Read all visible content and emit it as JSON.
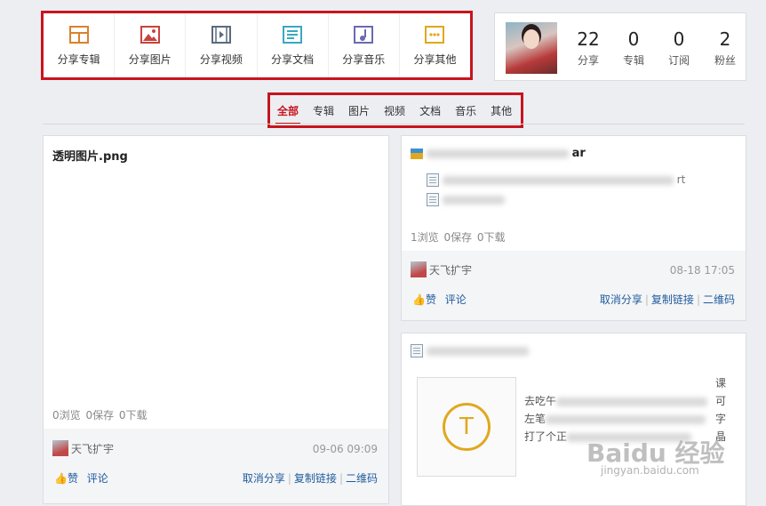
{
  "share_toolbar": {
    "buttons": [
      {
        "label": "分享专辑",
        "icon": "album-icon",
        "color": "#d9822b"
      },
      {
        "label": "分享图片",
        "icon": "image-icon",
        "color": "#c8443c"
      },
      {
        "label": "分享视频",
        "icon": "video-icon",
        "color": "#5a6b7d"
      },
      {
        "label": "分享文档",
        "icon": "document-icon",
        "color": "#3aa7c4"
      },
      {
        "label": "分享音乐",
        "icon": "music-icon",
        "color": "#6a6ab0"
      },
      {
        "label": "分享其他",
        "icon": "more-icon",
        "color": "#e0a81e"
      }
    ]
  },
  "profile": {
    "stats": [
      {
        "value": "22",
        "label": "分享"
      },
      {
        "value": "0",
        "label": "专辑"
      },
      {
        "value": "0",
        "label": "订阅"
      },
      {
        "value": "2",
        "label": "粉丝"
      }
    ]
  },
  "filter_tabs": [
    "全部",
    "专辑",
    "图片",
    "视频",
    "文档",
    "音乐",
    "其他"
  ],
  "card_left": {
    "title": "透明图片.png",
    "stats": "0浏览   0保存   0下载",
    "author": "天飞扩宇",
    "date": "09-06 09:09",
    "like": "赞",
    "comment": "评论",
    "actions": [
      "取消分享",
      "复制链接",
      "二维码"
    ]
  },
  "card_right_top": {
    "title_tail": "ar",
    "row1_tail": "rt",
    "stats": "1浏览   0保存   0下载",
    "author": "天飞扩宇",
    "date": "08-18 17:05",
    "like": "赞",
    "comment": "评论",
    "actions": [
      "取消分享",
      "复制链接",
      "二维码"
    ]
  },
  "card_right_bottom": {
    "preview_letter": "T",
    "text_fragments": [
      "去吃午",
      "左笔",
      "打了个正"
    ],
    "right_fragments": [
      "课",
      "可",
      "字",
      "晶"
    ]
  },
  "watermark": {
    "text": "Baidu 经验",
    "url": "jingyan.baidu.com"
  }
}
